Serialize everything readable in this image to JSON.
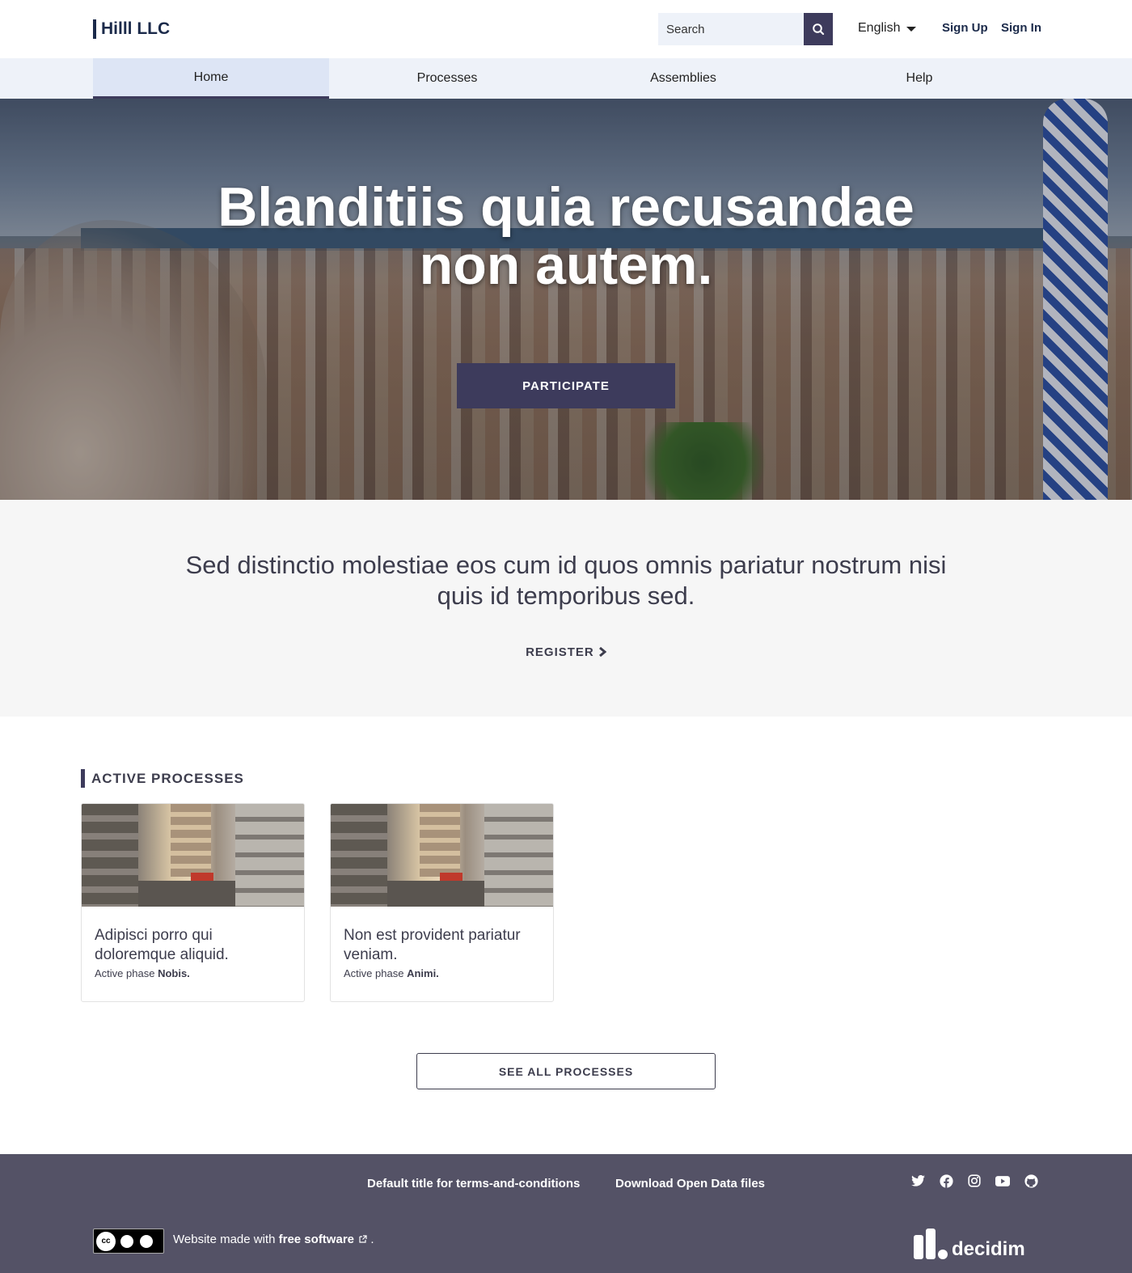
{
  "header": {
    "logo": "Hilll LLC",
    "search_placeholder": "Search",
    "language": "English",
    "sign_up": "Sign Up",
    "sign_in": "Sign In"
  },
  "nav": {
    "items": [
      {
        "label": "Home",
        "active": true
      },
      {
        "label": "Processes",
        "active": false
      },
      {
        "label": "Assemblies",
        "active": false
      },
      {
        "label": "Help",
        "active": false
      }
    ]
  },
  "hero": {
    "title": "Blanditiis quia recusandae non autem.",
    "cta": "PARTICIPATE"
  },
  "intro": {
    "text": "Sed distinctio molestiae eos cum id quos omnis pariatur nostrum nisi quis id temporibus sed.",
    "register": "REGISTER"
  },
  "active_processes": {
    "title": "ACTIVE PROCESSES",
    "cards": [
      {
        "title": "Adipisci porro qui doloremque aliquid.",
        "phase_label": "Active phase",
        "phase": "Nobis."
      },
      {
        "title": "Non est provident pariatur veniam.",
        "phase_label": "Active phase",
        "phase": "Animi."
      }
    ],
    "see_all": "SEE ALL PROCESSES"
  },
  "footer": {
    "terms": "Default title for terms-and-conditions",
    "open_data": "Download Open Data files",
    "socials": [
      "twitter-icon",
      "facebook-icon",
      "instagram-icon",
      "youtube-icon",
      "github-icon"
    ],
    "made_with_prefix": "Website made with",
    "made_with_link": "free software",
    "made_with_suffix": ".",
    "license_badge": "cc-by-sa-icon",
    "brand": "decidim"
  },
  "colors": {
    "primary": "#3d3b5c",
    "nav_bg": "#eef2f9",
    "footer_bg": "#545266",
    "logo": "#1b2a4a"
  }
}
